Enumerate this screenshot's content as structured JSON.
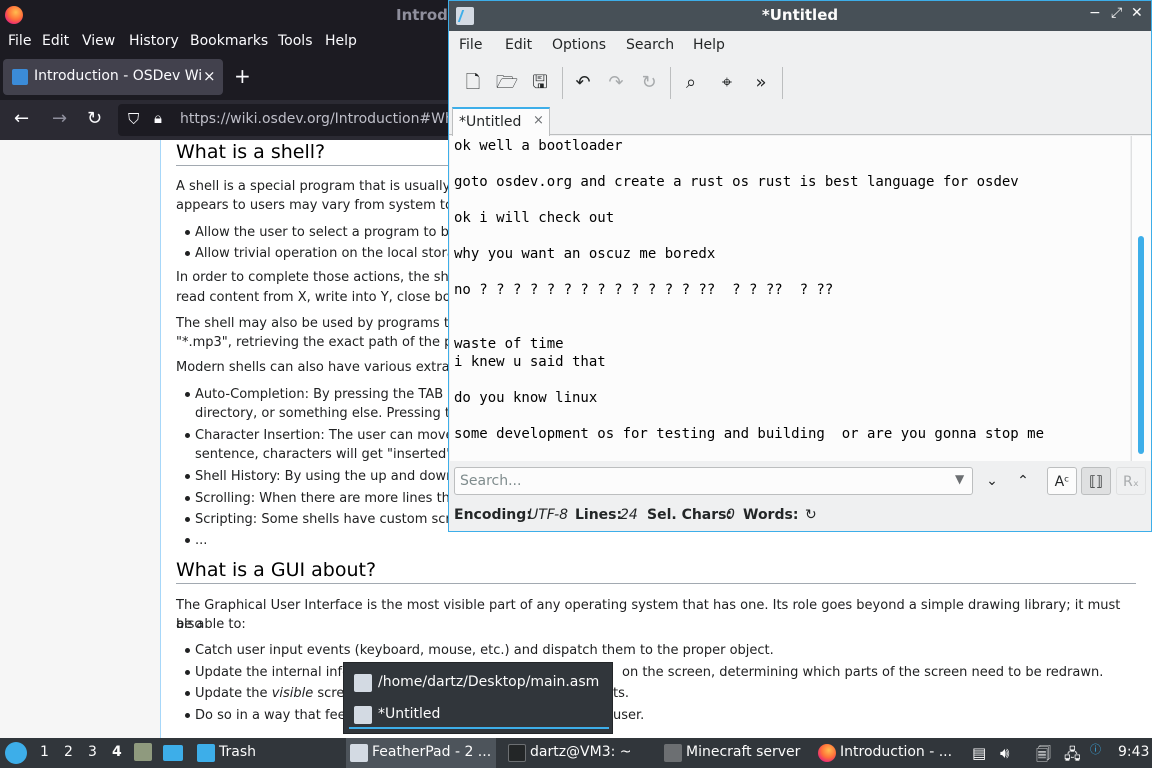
{
  "firefox": {
    "window_title": "Introd",
    "menu": [
      "File",
      "Edit",
      "View",
      "History",
      "Bookmarks",
      "Tools",
      "Help"
    ],
    "tab_label": "Introduction - OSDev Wik",
    "tab_close": "×",
    "new_tab": "+",
    "url": "https://wiki.osdev.org/Introduction#Wh",
    "content": {
      "h2_shell": "What is a shell?",
      "p_shell_1": "A shell is a special program that is usually",
      "p_shell_2": "appears to users may vary from system to",
      "li_1": "Allow the user to select a program to be",
      "li_2": "Allow trivial operation on the local stora",
      "p_actions_1": "In order to complete those actions, the she",
      "p_actions_2": "read content from X, write into Y, close bot",
      "p_programs_1": "The shell may also be used by programs th",
      "p_programs_2": "\"*.mp3\", retrieving the exact path of the p",
      "p_modern": "Modern shells can also have various extra",
      "li_auto_1": "Auto-Completion: By pressing the TAB (",
      "li_auto_2": "directory, or something else. Pressing th",
      "li_char_1": "Character Insertion: The user can move",
      "li_char_2": "sentence, characters will get \"inserted\"",
      "li_history": "Shell History: By using the up and down",
      "li_scroll": "Scrolling: When there are more lines tha",
      "li_script": "Scripting: Some shells have custom scr",
      "li_ellipsis": "...",
      "h2_gui": "What is a GUI about?",
      "p_gui_1": "The Graphical User Interface is the most visible part of any operating system that has one. Its role goes beyond a simple drawing library; it must also",
      "p_gui_2": "be able to:",
      "li_gui_1": "Catch user input events (keyboard, mouse, etc.) and dispatch them to the proper object.",
      "li_gui_2": "Update the internal info",
      "li_gui_2b": "on the screen, determining which parts of the screen need to be redrawn.",
      "li_gui_3a": "Update the ",
      "li_gui_3b": "visible",
      "li_gui_3c": " scre",
      "li_gui_3d": "ts.",
      "li_gui_4": "Do so in a way that fee",
      "li_gui_4b": "user."
    }
  },
  "featherpad": {
    "title": "*Untitled",
    "menu": [
      "File",
      "Edit",
      "Options",
      "Search",
      "Help"
    ],
    "tab_label": "*Untitled",
    "tab_close": "×",
    "lines": [
      "ok well a bootloader",
      "",
      "goto osdev.org and create a rust os rust is best language for osdev",
      "",
      "ok i will check out",
      "",
      "why you want an oscuz me boredx",
      "",
      "no ? ? ? ? ? ? ? ? ? ? ? ? ? ??  ? ? ??  ? ??",
      "",
      "",
      "waste of time",
      "i knew u said that",
      "",
      "do you know linux",
      "",
      "some development os for testing and building  or are you gonna stop me"
    ],
    "search_placeholder": "Search...",
    "status": {
      "encoding_label": "Encoding:",
      "encoding_value": "UTF-8",
      "lines_label": "Lines:",
      "lines_value": "24",
      "sel_label": "Sel. Chars:",
      "sel_value": "0",
      "words_label": "Words:"
    }
  },
  "popup": {
    "items": [
      "/home/dartz/Desktop/main.asm",
      "*Untitled"
    ]
  },
  "taskbar": {
    "desktops": [
      "1",
      "2",
      "3",
      "4"
    ],
    "trash": "Trash",
    "tasks": [
      "FeatherPad - 2 ...",
      "dartz@VM3: ~",
      "Minecraft server",
      "Introduction - ..."
    ],
    "clock": "9:43"
  }
}
